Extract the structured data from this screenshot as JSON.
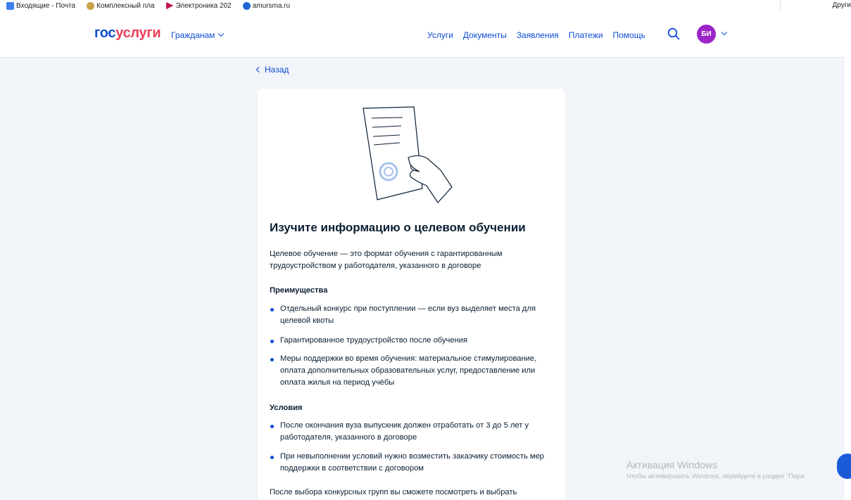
{
  "bookmarks": {
    "items": [
      {
        "label": "Входящие - Почта",
        "icon": "mail-icon",
        "color": "#3c7ff0"
      },
      {
        "label": "Комплексный пла",
        "icon": "shield-emblem-icon",
        "color": "#c9a24a"
      },
      {
        "label": "Электроника 202",
        "icon": "play-icon",
        "color": "#c2185b"
      },
      {
        "label": "amursma.ru",
        "icon": "globe-icon",
        "color": "#1e66d8"
      }
    ],
    "other_label": "Други"
  },
  "header": {
    "logo_part1": "гос",
    "logo_part2": "услуги",
    "citizens_label": "Гражданам",
    "nav": [
      "Услуги",
      "Документы",
      "Заявления",
      "Платежи",
      "Помощь"
    ],
    "avatar_initials": "БИ"
  },
  "colors": {
    "brand_blue": "#0d4cd3",
    "brand_red": "#ee3f58",
    "avatar": "#9b25c8",
    "page_bg": "#f1f4f9"
  },
  "back_label": "Назад",
  "card": {
    "title": "Изучите информацию о целевом обучении",
    "intro": "Целевое обучение — это формат обучения с гарантированным трудоустройством у работодателя, указанного в договоре",
    "advantages_heading": "Преимущества",
    "advantages": [
      "Отдельный конкурс при поступлении — если вуз выделяет места для целевой квоты",
      "Гарантированное трудоустройство после обучения",
      "Меры поддержки во время обучения: материальное стимулирование, оплата дополнительных образовательных услуг, предоставление или оплата жилья на период учёбы"
    ],
    "conditions_heading": "Условия",
    "conditions": [
      "После окончания вуза выпускник должен отработать от 3 до 5 лет у работодателя, указанного в договоре",
      "При невыполнении условий нужно возместить заказчику стоимость мер поддержки в соответствии с договором"
    ],
    "outro": "После выбора конкурсных групп вы сможете посмотреть и выбрать"
  },
  "watermark": {
    "line1": "Активация Windows",
    "line2": "Чтобы активировать Windows, перейдите в раздел \"Пара"
  }
}
